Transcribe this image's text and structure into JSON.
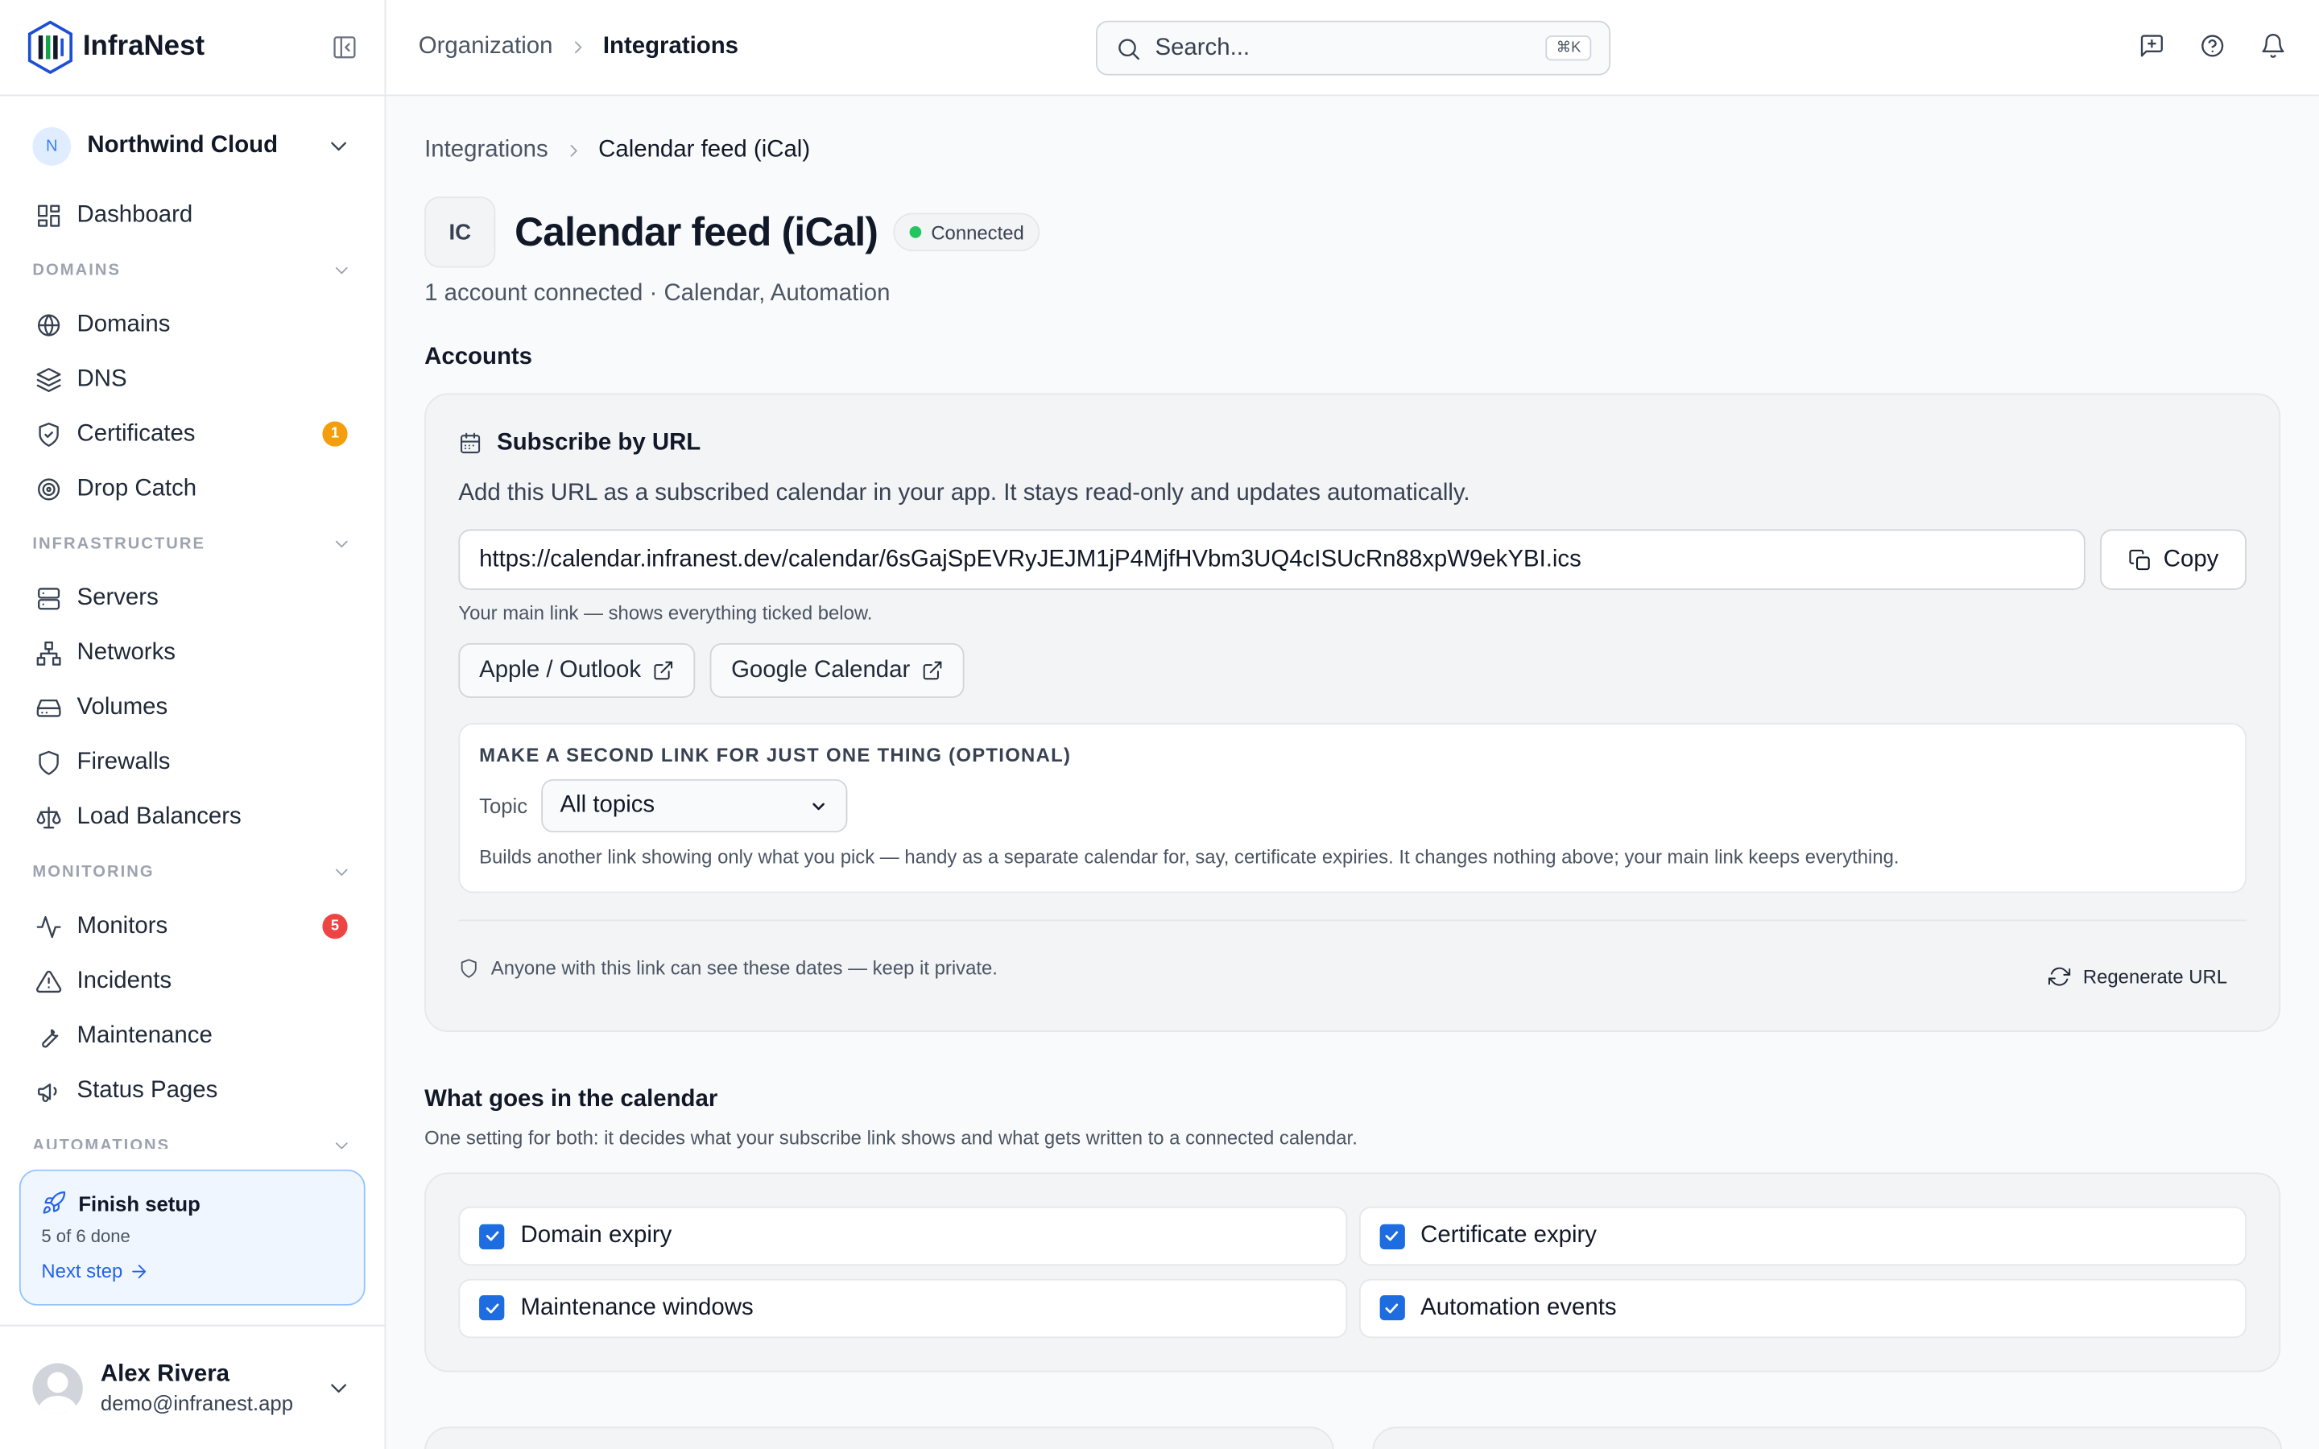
{
  "app": {
    "name": "InfraNest"
  },
  "org": {
    "avatar": "N",
    "name": "Northwind Cloud"
  },
  "nav": {
    "dashboard": "Dashboard",
    "sections": [
      {
        "title": "DOMAINS",
        "items": [
          {
            "label": "Domains",
            "icon": "globe-icon"
          },
          {
            "label": "DNS",
            "icon": "layers-icon"
          },
          {
            "label": "Certificates",
            "icon": "shield-check-icon",
            "badge": "1",
            "badge_color": "#f59e0b"
          },
          {
            "label": "Drop Catch",
            "icon": "target-icon"
          }
        ]
      },
      {
        "title": "INFRASTRUCTURE",
        "items": [
          {
            "label": "Servers",
            "icon": "server-icon"
          },
          {
            "label": "Networks",
            "icon": "network-icon"
          },
          {
            "label": "Volumes",
            "icon": "hard-drive-icon"
          },
          {
            "label": "Firewalls",
            "icon": "shield-icon"
          },
          {
            "label": "Load Balancers",
            "icon": "scale-icon"
          }
        ]
      },
      {
        "title": "MONITORING",
        "items": [
          {
            "label": "Monitors",
            "icon": "activity-icon",
            "badge": "5",
            "badge_color": "#ef4444"
          },
          {
            "label": "Incidents",
            "icon": "alert-triangle-icon"
          },
          {
            "label": "Maintenance",
            "icon": "wrench-icon"
          },
          {
            "label": "Status Pages",
            "icon": "megaphone-icon"
          }
        ]
      },
      {
        "title": "AUTOMATIONS",
        "items": []
      }
    ]
  },
  "setup": {
    "title": "Finish setup",
    "progress": "5 of 6 done",
    "next": "Next step"
  },
  "user": {
    "name": "Alex Rivera",
    "email": "demo@infranest.app"
  },
  "topbar": {
    "breadcrumb": [
      "Organization",
      "Integrations"
    ],
    "search_placeholder": "Search...",
    "search_shortcut": "⌘K"
  },
  "page": {
    "breadcrumb": [
      "Integrations",
      "Calendar feed (iCal)"
    ],
    "icon_text": "IC",
    "title": "Calendar feed (iCal)",
    "status": "Connected",
    "status_color": "#22c55e",
    "subtitle": "1 account connected · Calendar, Automation",
    "accounts_heading": "Accounts"
  },
  "subscribe": {
    "heading": "Subscribe by URL",
    "description": "Add this URL as a subscribed calendar in your app. It stays read-only and updates automatically.",
    "url": "https://calendar.infranest.dev/calendar/6sGajSpEVRyJEJM1jP4MjfHVbm3UQ4cISUcRn88xpW9ekYBI.ics",
    "copy_label": "Copy",
    "hint": "Your main link — shows everything ticked below.",
    "apple_label": "Apple / Outlook",
    "google_label": "Google Calendar",
    "second_heading": "MAKE A SECOND LINK FOR JUST ONE THING (OPTIONAL)",
    "topic_label": "Topic",
    "topic_value": "All topics",
    "second_note": "Builds another link showing only what you pick — handy as a separate calendar for, say, certificate expiries. It changes nothing above; your main link keeps everything.",
    "privacy": "Anyone with this link can see these dates — keep it private.",
    "regenerate_label": "Regenerate URL"
  },
  "calendar": {
    "heading": "What goes in the calendar",
    "description": "One setting for both: it decides what your subscribe link shows and what gets written to a connected calendar.",
    "options": [
      {
        "label": "Domain expiry",
        "checked": true
      },
      {
        "label": "Certificate expiry",
        "checked": true
      },
      {
        "label": "Maintenance windows",
        "checked": true
      },
      {
        "label": "Automation events",
        "checked": true
      }
    ]
  }
}
